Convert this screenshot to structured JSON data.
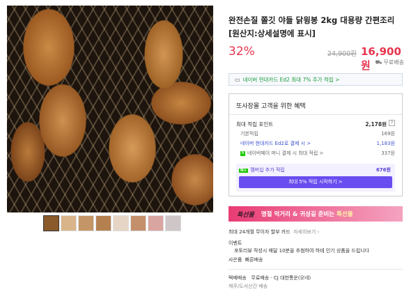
{
  "product": {
    "title": "완전손질 쫄깃 야들 닭윙봉 2kg 대용량 간편조리 [원산지:상세설명에 표시]",
    "discount": "32%",
    "original_price": "24,900원",
    "sale_price": "16,900원",
    "shipping": "무료배송"
  },
  "card_banner": "네이버 현대카드 Ed2 최대 7% 추가 적립 >",
  "benefits": {
    "title": "또사장몰 고객을 위한 혜택",
    "max_points_label": "최대 적립 포인트",
    "max_points_value": "2,178원",
    "help": "?",
    "rows": [
      {
        "label": "기본적립",
        "value": "169원"
      },
      {
        "label": "네이버 현대카드 Ed2로 결제 시 >",
        "value": "1,183원"
      },
      {
        "label": "네이버페이 머니 결제 시 최대 적립 >",
        "value": "337원"
      }
    ],
    "membership_label": "멤버십 추가 적립",
    "membership_badge": "N+",
    "membership_value": "676원",
    "membership_button": "최대 5% 적립 시작하기 >"
  },
  "promo": {
    "logo": "특선몰",
    "text_before": "명절 먹거리 & 귀성길 준비는 ",
    "text_highlight": "특선몰"
  },
  "card_installment": {
    "label": "최대 24개월 무이자 할부 카드",
    "link": "자세히보기"
  },
  "event": {
    "label": "이벤트",
    "text": "포토리뷰 작성시 매달 10분을 추첨하여 하테 인기 상품을 드립니다"
  },
  "gift": {
    "label": "사은품",
    "text": "빠른배송"
  },
  "delivery": {
    "label": "택배배송",
    "text": "무료배송 · CJ 대한통운(오네)",
    "extra": "제주/도서산간 배송"
  },
  "thumbnails": 8
}
